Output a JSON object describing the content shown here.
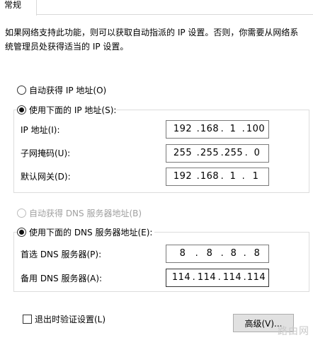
{
  "tab": {
    "general": "常规"
  },
  "description": "如果网络支持此功能，则可以获取自动指派的 IP 设置。否则，你需要从网络系统管理员处获得适当的 IP 设置。",
  "ip": {
    "auto_label": "自动获得 IP 地址(O)",
    "manual_label": "使用下面的 IP 地址(S):",
    "address_label": "IP 地址(I):",
    "address": [
      "192",
      "168",
      "1",
      "100"
    ],
    "subnet_label": "子网掩码(U):",
    "subnet": [
      "255",
      "255",
      "255",
      "0"
    ],
    "gateway_label": "默认网关(D):",
    "gateway": [
      "192",
      "168",
      "1",
      "1"
    ]
  },
  "dns": {
    "auto_label": "自动获得 DNS 服务器地址(B)",
    "manual_label": "使用下面的 DNS 服务器地址(E):",
    "preferred_label": "首选 DNS 服务器(P):",
    "preferred": [
      "8",
      "8",
      "8",
      "8"
    ],
    "alternate_label": "备用 DNS 服务器(A):",
    "alternate": [
      "114",
      "114",
      "114",
      "114"
    ]
  },
  "validate_label": "退出时验证设置(L)",
  "advanced_button": "高级(V)...",
  "watermark": "路由网"
}
